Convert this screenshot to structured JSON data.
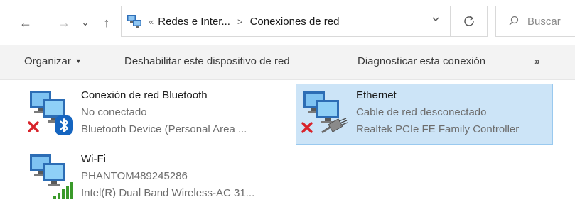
{
  "nav": {
    "back_glyph": "←",
    "forward_glyph": "→",
    "recent_glyph": "⌄",
    "up_glyph": "↑"
  },
  "address": {
    "overflow": "«",
    "crumbs": [
      "Redes e Inter...",
      "Conexiones de red"
    ],
    "separator": ">"
  },
  "search": {
    "placeholder": "Buscar"
  },
  "toolbar": {
    "organize": "Organizar",
    "disable": "Deshabilitar este dispositivo de red",
    "diagnose": "Diagnosticar esta conexión",
    "more": "»"
  },
  "connections": [
    {
      "name": "Conexión de red Bluetooth",
      "status": "No conectado",
      "device": "Bluetooth Device (Personal Area ...",
      "overlay": "bluetooth-icon",
      "disconnected": true,
      "selected": false
    },
    {
      "name": "Ethernet",
      "status": "Cable de red desconectado",
      "device": "Realtek PCIe FE Family Controller",
      "overlay": "ethernet-cable-icon",
      "disconnected": true,
      "selected": true
    },
    {
      "name": "Wi-Fi",
      "status": "PHANTOM489245286",
      "device": "Intel(R) Dual Band Wireless-AC 31...",
      "overlay": "signal-bars-icon",
      "disconnected": false,
      "selected": false
    }
  ],
  "colors": {
    "selection_bg": "#cce4f7",
    "selection_border": "#99c9ef",
    "error_red": "#d8232a",
    "bluetooth_blue": "#1565c0",
    "signal_green": "#3a9a2a"
  }
}
